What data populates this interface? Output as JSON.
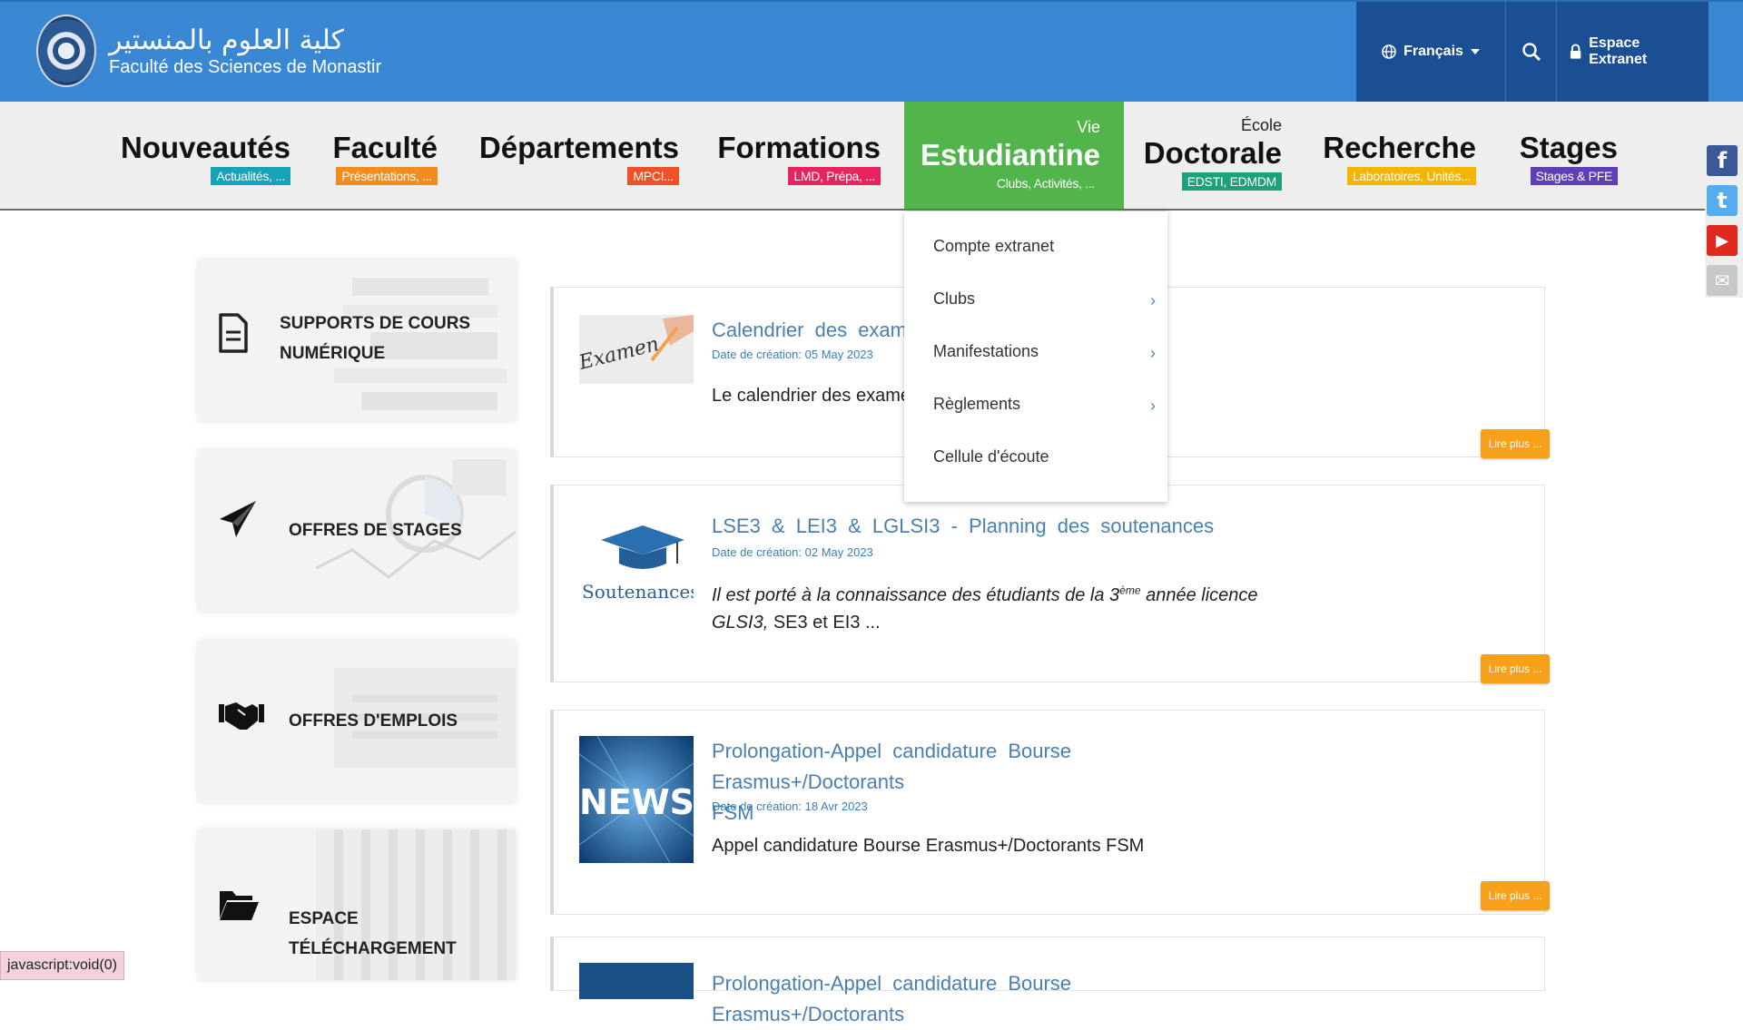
{
  "header": {
    "logo_arabic": "كلية العلوم بالمنستير",
    "logo_french": "Faculté des Sciences de Monastir",
    "language": "Français",
    "extranet_label": "Espace Extranet"
  },
  "nav": [
    {
      "pre": "",
      "title": "Nouveautés",
      "sub": "Actualités, ...",
      "color": "#17a2b8"
    },
    {
      "pre": "",
      "title": "Faculté",
      "sub": "Présentations, ...",
      "color": "#f28c1f"
    },
    {
      "pre": "",
      "title": "Départements",
      "sub": "MPCI...",
      "color": "#ef5028"
    },
    {
      "pre": "",
      "title": "Formations",
      "sub": "LMD, Prépa, ...",
      "color": "#e8245e"
    },
    {
      "pre": "Vie",
      "title": "Estudiantine",
      "sub": "Clubs, Activités, ...",
      "color": "#52b54b"
    },
    {
      "pre": "École",
      "title": "Doctorale",
      "sub": "EDSTI, EDMDM",
      "color": "#1aa37a"
    },
    {
      "pre": "",
      "title": "Recherche",
      "sub": "Laboratoires, Unités...",
      "color": "#f5b400"
    },
    {
      "pre": "",
      "title": "Stages",
      "sub": "Stages & PFE",
      "color": "#5e3fb5"
    }
  ],
  "dropdown": [
    {
      "label": "Compte extranet",
      "has_sub": false
    },
    {
      "label": "Clubs",
      "has_sub": true
    },
    {
      "label": "Manifestations",
      "has_sub": true
    },
    {
      "label": "Règlements",
      "has_sub": true
    },
    {
      "label": "Cellule d'écoute",
      "has_sub": false
    }
  ],
  "panels": [
    {
      "line1": "SUPPORTS DE COURS",
      "line2": "NUMÉRIQUE",
      "icon": "document-icon"
    },
    {
      "line1": "OFFRES DE STAGES",
      "line2": "",
      "icon": "paper-plane-icon"
    },
    {
      "line1": "OFFRES D'EMPLOIS",
      "line2": "",
      "icon": "handshake-icon"
    },
    {
      "line1": "ESPACE TÉLÉCHARGEMENT",
      "line2": "",
      "icon": "folder-open-icon"
    }
  ],
  "articles": [
    {
      "title": "Calendrier des examens",
      "date": "Date de création: 05 May 2023",
      "body": "Le calendrier des examens",
      "thumb_text": "Examen",
      "read_more": "Lire plus ..."
    },
    {
      "title": "LSE3 & LEI3 & LGLSI3 - Planning des soutenances",
      "date": "Date de création: 02 May 2023",
      "body_part1": "Il est porté à la connaissance des étudiants de la 3",
      "body_sup": "ème",
      "body_part2": " année licence",
      "body_part3": "GLSI3,",
      "body_part4": " SE3 et EI3  ...",
      "thumb_text": "Soutenances",
      "read_more": "Lire plus ..."
    },
    {
      "title_line1": "Prolongation-Appel candidature Bourse Erasmus+/Doctorants",
      "title_line2": "FSM",
      "date": "Date de création: 18 Avr 2023",
      "body": "Appel candidature Bourse Erasmus+/Doctorants FSM",
      "thumb_text": "NEWS",
      "read_more": "Lire plus ..."
    },
    {
      "title": "Prolongation-Appel candidature Bourse Erasmus+/Doctorants"
    }
  ],
  "social": [
    {
      "icon": "facebook-icon",
      "glyph": "f",
      "color": "#3b5998"
    },
    {
      "icon": "twitter-icon",
      "glyph": "t",
      "color": "#55acee"
    },
    {
      "icon": "youtube-icon",
      "glyph": "▶",
      "color": "#e02a20"
    },
    {
      "icon": "mail-icon",
      "glyph": "✉",
      "color": "#b8b8b8"
    }
  ],
  "statusbar": "javascript:void(0)"
}
